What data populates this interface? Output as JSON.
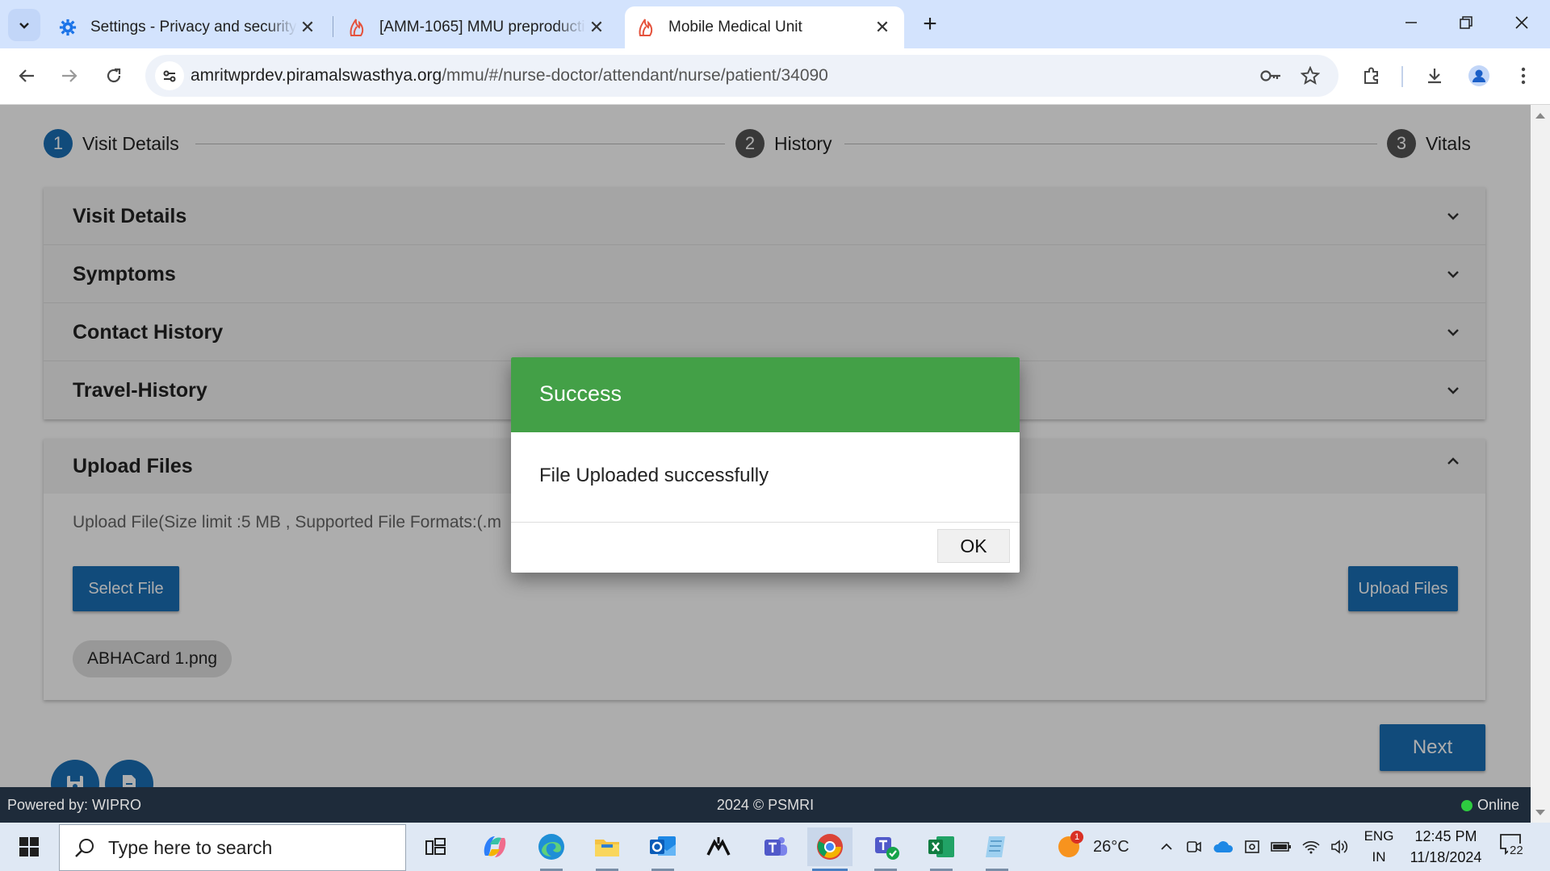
{
  "browser": {
    "tabs": [
      {
        "title": "Settings - Privacy and security",
        "icon": "gear-icon",
        "active": false
      },
      {
        "title": "[AMM-1065] MMU preproducti",
        "icon": "app-flame-icon",
        "active": false
      },
      {
        "title": "Mobile Medical Unit",
        "icon": "app-flame-icon",
        "active": true
      }
    ],
    "url_host": "amritwprdev.piramalswasthya.org",
    "url_path": "/mmu/#/nurse-doctor/attendant/nurse/patient/34090"
  },
  "stepper": {
    "steps": [
      {
        "number": "1",
        "label": "Visit Details",
        "color": "#1a6fb5"
      },
      {
        "number": "2",
        "label": "History",
        "color": "#555555"
      },
      {
        "number": "3",
        "label": "Vitals",
        "color": "#555555"
      }
    ]
  },
  "accordion": {
    "sections": [
      "Visit Details",
      "Symptoms",
      "Contact History",
      "Travel-History"
    ]
  },
  "upload": {
    "title": "Upload Files",
    "hint": "Upload File(Size limit :5 MB , Supported File Formats:(.m",
    "select_label": "Select File",
    "upload_label": "Upload Files",
    "file_chip": "ABHACard 1.png"
  },
  "next_label": "Next",
  "footer": {
    "left": "Powered by: WIPRO",
    "center": "2024 © PSMRI",
    "status": "Online"
  },
  "dialog": {
    "title": "Success",
    "message": "File Uploaded successfully",
    "ok_label": "OK",
    "header_color": "#43a047"
  },
  "taskbar": {
    "search_placeholder": "Type here to search",
    "weather": "26°C",
    "weather_badge": "1",
    "lang_line1": "ENG",
    "lang_line2": "IN",
    "time": "12:45 PM",
    "date": "11/18/2024",
    "notifications": "22"
  }
}
